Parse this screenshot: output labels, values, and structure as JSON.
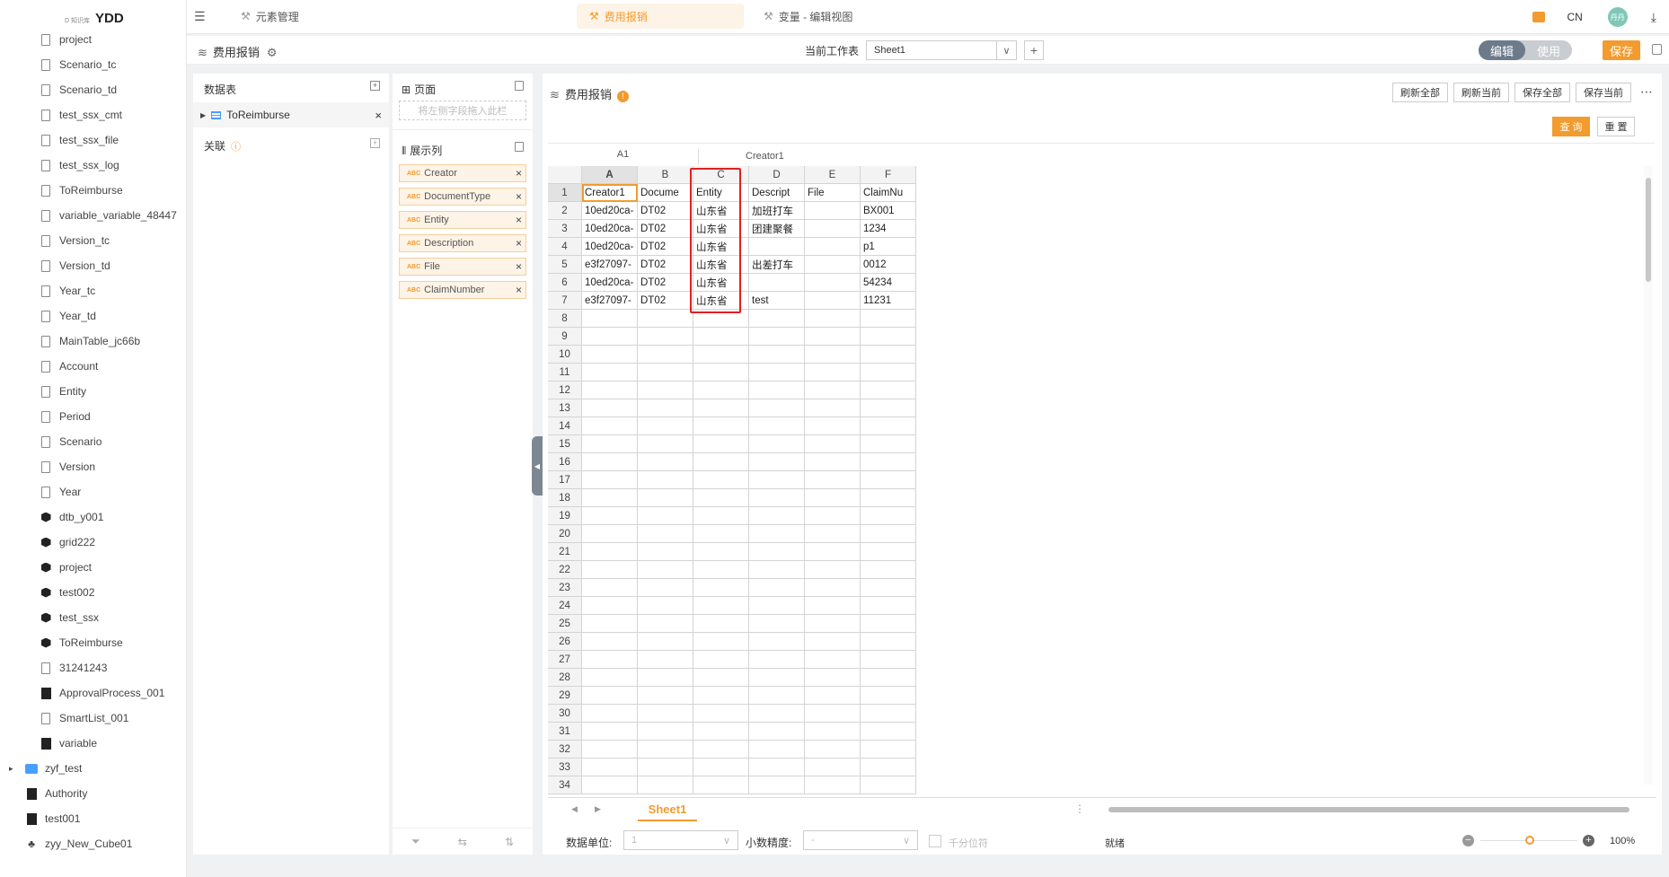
{
  "app": {
    "logo": "YDD",
    "logo_small": "D 知识库"
  },
  "tree": [
    {
      "label": "project",
      "icon": "doc"
    },
    {
      "label": "Scenario_tc",
      "icon": "doc"
    },
    {
      "label": "Scenario_td",
      "icon": "doc"
    },
    {
      "label": "test_ssx_cmt",
      "icon": "doc"
    },
    {
      "label": "test_ssx_file",
      "icon": "doc"
    },
    {
      "label": "test_ssx_log",
      "icon": "doc"
    },
    {
      "label": "ToReimburse",
      "icon": "doc"
    },
    {
      "label": "variable_variable_48447",
      "icon": "doc"
    },
    {
      "label": "Version_tc",
      "icon": "doc"
    },
    {
      "label": "Version_td",
      "icon": "doc"
    },
    {
      "label": "Year_tc",
      "icon": "doc"
    },
    {
      "label": "Year_td",
      "icon": "doc"
    },
    {
      "label": "MainTable_jc66b",
      "icon": "doc"
    },
    {
      "label": "Account",
      "icon": "doc"
    },
    {
      "label": "Entity",
      "icon": "doc"
    },
    {
      "label": "Period",
      "icon": "doc"
    },
    {
      "label": "Scenario",
      "icon": "doc"
    },
    {
      "label": "Version",
      "icon": "doc"
    },
    {
      "label": "Year",
      "icon": "doc"
    },
    {
      "label": "dtb_y001",
      "icon": "cube"
    },
    {
      "label": "grid222",
      "icon": "cube"
    },
    {
      "label": "project",
      "icon": "cube"
    },
    {
      "label": "test002",
      "icon": "cube"
    },
    {
      "label": "test_ssx",
      "icon": "cube"
    },
    {
      "label": "ToReimburse",
      "icon": "cube"
    },
    {
      "label": "31241243",
      "icon": "doc"
    },
    {
      "label": "ApprovalProcess_001",
      "icon": "blk"
    },
    {
      "label": "SmartList_001",
      "icon": "doc"
    },
    {
      "label": "variable",
      "icon": "blk"
    },
    {
      "label": "zyf_test",
      "icon": "folder"
    },
    {
      "label": "Authority",
      "icon": "blk"
    },
    {
      "label": "test001",
      "icon": "blk"
    },
    {
      "label": "zyy_New_Cube01",
      "icon": "net"
    }
  ],
  "tabs": [
    {
      "label": "元素管理"
    },
    {
      "label": "费用报销"
    },
    {
      "label": "变量 - 编辑视图"
    }
  ],
  "topright": {
    "lang": "CN",
    "avatar": "丹丹"
  },
  "subbar": {
    "title": "费用报销",
    "sheet_label": "当前工作表",
    "sheet_value": "Sheet1",
    "mode_edit": "编辑",
    "mode_use": "使用",
    "save": "保存"
  },
  "datatable": {
    "title": "数据表",
    "item": "ToReimburse",
    "relation": "关联"
  },
  "page": {
    "title": "页面",
    "placeholder": "将左侧字段拖入此栏"
  },
  "display": {
    "title": "展示列",
    "fields": [
      "Creator",
      "DocumentType",
      "Entity",
      "Description",
      "File",
      "ClaimNumber"
    ]
  },
  "report": {
    "title": "费用报销",
    "refresh_all": "刷新全部",
    "refresh_current": "刷新当前",
    "save_all": "保存全部",
    "save_current": "保存当前",
    "query": "查 询",
    "reset": "重 置"
  },
  "formula": {
    "cell_ref": "A1",
    "value": "Creator1"
  },
  "sheet": {
    "columns": [
      "A",
      "B",
      "C",
      "D",
      "E",
      "F"
    ],
    "rows": [
      [
        "Creator1",
        "Docume",
        "Entity",
        "Descript",
        "File",
        "ClaimNu"
      ],
      [
        "10ed20ca-",
        "DT02",
        "山东省",
        "加班打车",
        "",
        "BX001"
      ],
      [
        "10ed20ca-",
        "DT02",
        "山东省",
        "团建聚餐",
        "",
        "1234"
      ],
      [
        "10ed20ca-",
        "DT02",
        "山东省",
        "",
        "",
        "p1"
      ],
      [
        "e3f27097-",
        "DT02",
        "山东省",
        "出差打车",
        "",
        "0012"
      ],
      [
        "10ed20ca-",
        "DT02",
        "山东省",
        "",
        "",
        "54234"
      ],
      [
        "e3f27097-",
        "DT02",
        "山东省",
        "test",
        "",
        "11231"
      ]
    ],
    "row_count": 34,
    "tab": "Sheet1"
  },
  "status": {
    "unit_label": "数据单位:",
    "unit_value": "1",
    "precision_label": "小数精度:",
    "precision_value": "-",
    "thousands": "千分位符",
    "ready": "就绪",
    "zoom": "100%"
  },
  "colors": {
    "accent": "#f29b2f",
    "highlight": "#e02020"
  }
}
